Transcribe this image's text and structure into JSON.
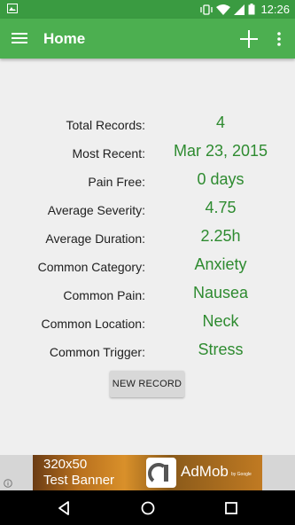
{
  "status": {
    "time": "12:26"
  },
  "app": {
    "title": "Home"
  },
  "stats": [
    {
      "label": "Total Records:",
      "value": "4"
    },
    {
      "label": "Most Recent:",
      "value": "Mar 23, 2015"
    },
    {
      "label": "Pain Free:",
      "value": "0 days"
    },
    {
      "label": "Average Severity:",
      "value": "4.75"
    },
    {
      "label": "Average Duration:",
      "value": "2.25h"
    },
    {
      "label": "Common Category:",
      "value": "Anxiety"
    },
    {
      "label": "Common Pain:",
      "value": "Nausea"
    },
    {
      "label": "Common Location:",
      "value": "Neck"
    },
    {
      "label": "Common Trigger:",
      "value": "Stress"
    }
  ],
  "new_record_label": "NEW RECORD",
  "ad": {
    "line1": "320x50",
    "line2": "Test Banner",
    "brand": "AdMob",
    "brand_sub": "by Google"
  },
  "colors": {
    "appbar": "#4caf50",
    "statusbar": "#3a9b41",
    "value": "#2e8b30"
  }
}
